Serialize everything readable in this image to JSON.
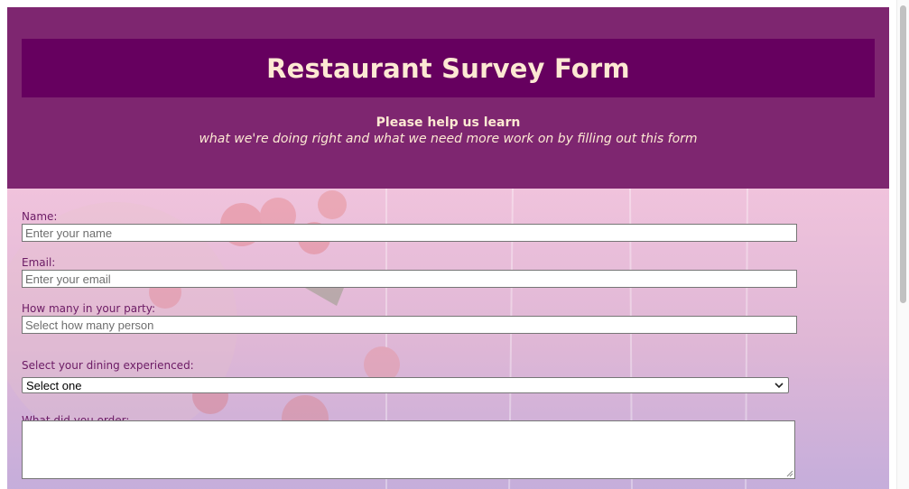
{
  "header": {
    "title": "Restaurant Survey Form",
    "subtitle_bold": "Please help us learn",
    "subtitle_italic": "what we're doing right and what we need more work on by filling out this form"
  },
  "form": {
    "name_label": "Name:",
    "name_placeholder": "Enter your name",
    "email_label": "Email:",
    "email_placeholder": "Enter your email",
    "party_label": "How many in your party:",
    "party_placeholder": "Select how many person",
    "dining_label": "Select your dining experienced:",
    "dining_selected": "Select one",
    "order_label": "What did you order:"
  },
  "colors": {
    "header_bg": "#7e2670",
    "title_box_bg": "#66005f",
    "title_text": "#fde9d3",
    "label_text": "#6b1a64"
  },
  "icons": {
    "dropdown": "chevron-down-icon",
    "resize": "resize-grip-icon"
  }
}
